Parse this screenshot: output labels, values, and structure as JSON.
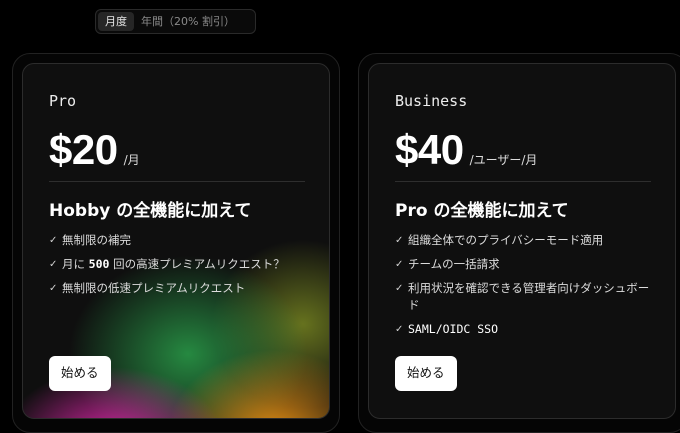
{
  "billing_toggle": {
    "monthly_label": "月度",
    "yearly_label": "年間（20% 割引）",
    "selected": "monthly"
  },
  "plans": [
    {
      "name": "Pro",
      "price": "$20",
      "period": "/月",
      "headline": "Hobby の全機能に加えて",
      "features": [
        {
          "text": "無制限の補完"
        },
        {
          "prefix": "月に ",
          "highlight": "500",
          "suffix": " 回の高速プレミアムリクエスト？"
        },
        {
          "text": "無制限の低速プレミアムリクエスト"
        }
      ],
      "button_label": "始める"
    },
    {
      "name": "Business",
      "price": "$40",
      "period": "/ユーザー/月",
      "headline": "Pro の全機能に加えて",
      "features": [
        {
          "text": "組織全体でのプライバシーモード適用"
        },
        {
          "text": "チームの一括請求"
        },
        {
          "text": "利用状況を確認できる管理者向けダッシュボード"
        },
        {
          "text": "SAML/OIDC SSO"
        }
      ],
      "button_label": "始める"
    }
  ],
  "icons": {
    "feature_marker": "check-icon"
  },
  "colors": {
    "background": "#000000",
    "button_bg": "#ffffff",
    "text": "#e8e8e8"
  }
}
